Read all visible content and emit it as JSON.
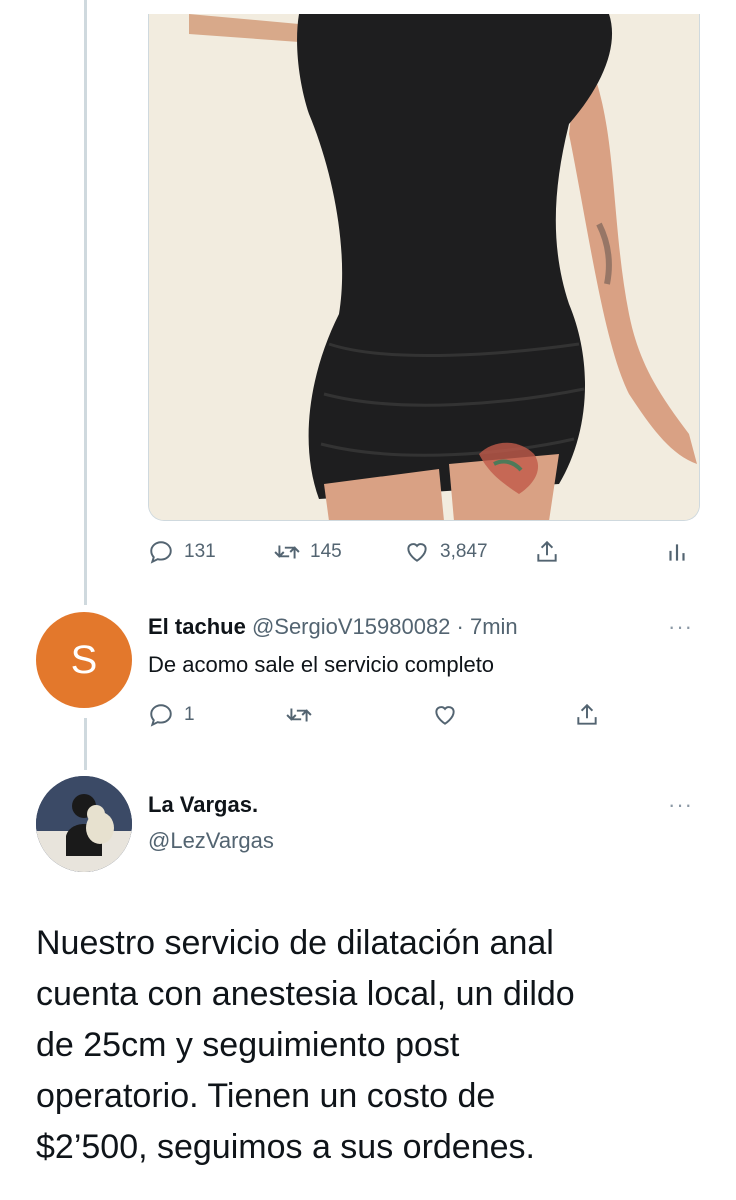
{
  "top_tweet": {
    "stats": {
      "replies": "131",
      "retweets": "145",
      "likes": "3,847"
    },
    "icons": [
      "reply-icon",
      "retweet-icon",
      "like-icon",
      "share-icon",
      "analytics-icon"
    ]
  },
  "reply": {
    "avatar_letter": "S",
    "name": "El tachue",
    "handle": "@SergioV15980082",
    "separator": " · ",
    "time": "7min",
    "text": "De acomo sale el servicio completo",
    "reply_count": "1",
    "more": "···",
    "colors": {
      "avatar_bg": "#e3782c"
    }
  },
  "main_tweet": {
    "name": "La Vargas.",
    "handle": "@LezVargas",
    "more": "···",
    "lines": [
      "Nuestro servicio de dilatación anal",
      "cuenta con anestesia local, un dildo",
      "de 25cm y seguimiento post",
      "operatorio. Tienen un costo de",
      "$2’500, seguimos a sus ordenes."
    ]
  },
  "colors": {
    "text": "#0f1419",
    "secondary": "#536471",
    "border": "#cfd9de"
  }
}
